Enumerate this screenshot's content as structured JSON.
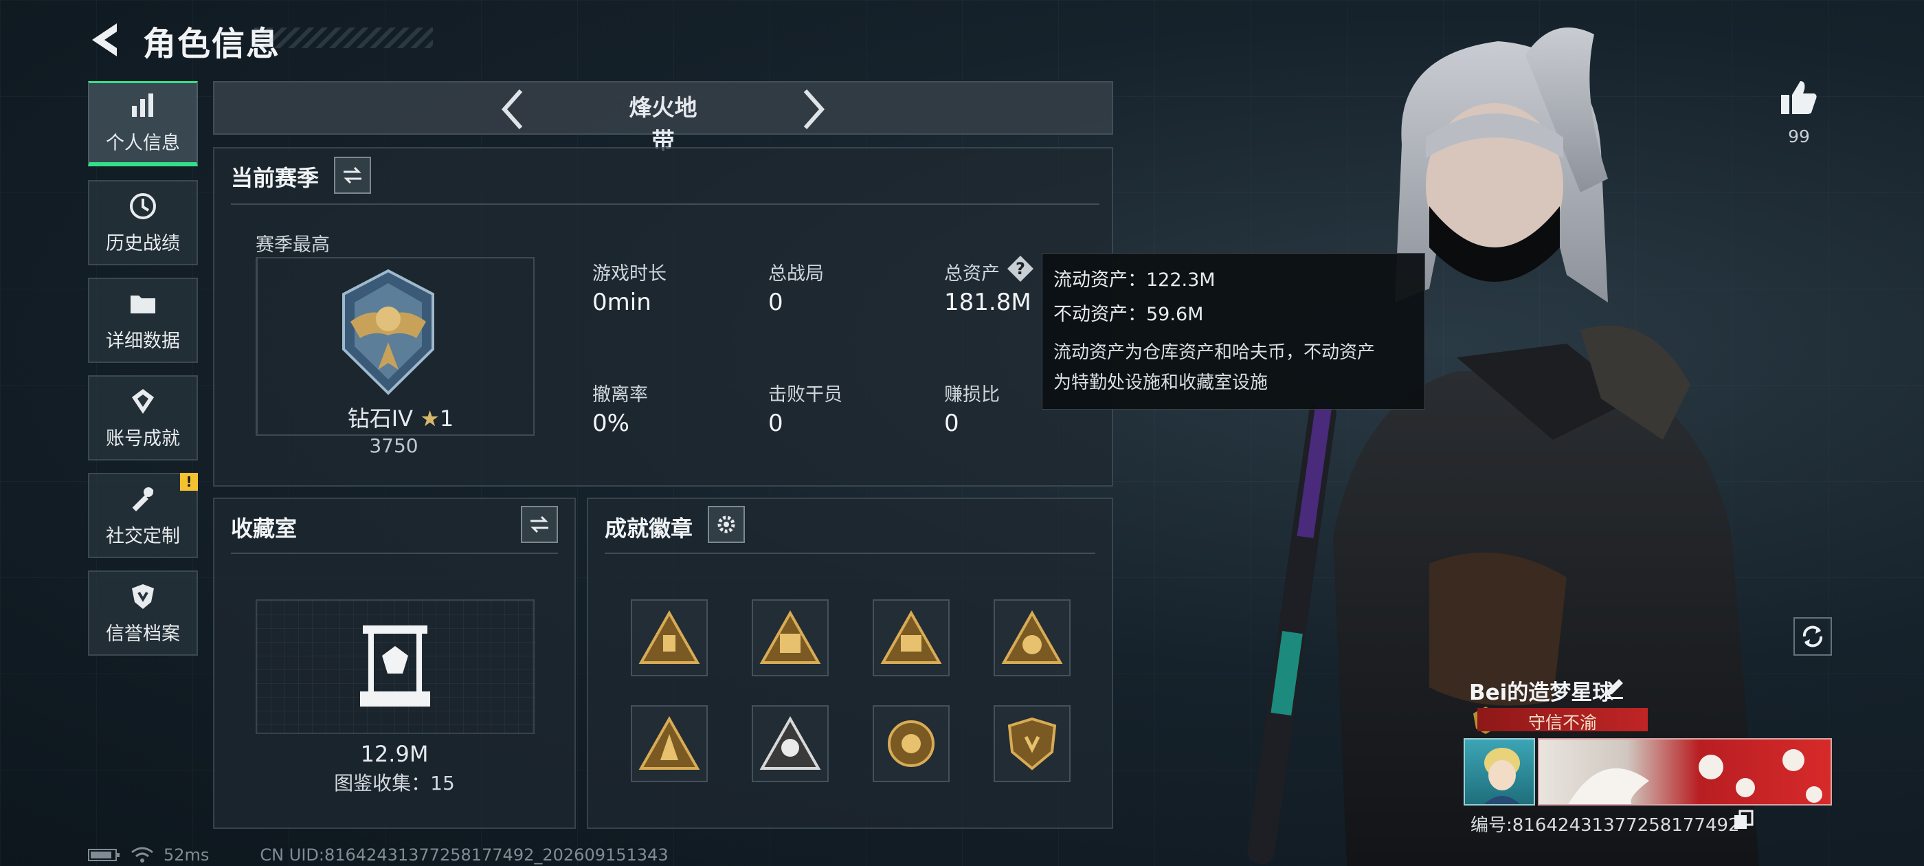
{
  "header": {
    "title": "角色信息"
  },
  "sidebar": {
    "items": [
      {
        "label": "个人信息",
        "active": true
      },
      {
        "label": "历史战绩"
      },
      {
        "label": "详细数据"
      },
      {
        "label": "账号成就"
      },
      {
        "label": "社交定制",
        "badge": "!"
      },
      {
        "label": "信誉档案"
      }
    ]
  },
  "mode": {
    "title": "烽火地带"
  },
  "season": {
    "title": "当前赛季",
    "best_label": "赛季最高",
    "rank_name": "钻石IV",
    "rank_stars": "1",
    "rank_points": "3750",
    "stats": [
      {
        "label": "游戏时长",
        "value": "0min"
      },
      {
        "label": "总战局",
        "value": "0"
      },
      {
        "label": "总资产",
        "value": "181.8M"
      },
      {
        "label": "撤离率",
        "value": "0%"
      },
      {
        "label": "击败干员",
        "value": "0"
      },
      {
        "label": "赚损比",
        "value": "0"
      }
    ]
  },
  "tooltip": {
    "liquid": "流动资产：122.3M",
    "fixed": "不动资产：59.6M",
    "desc_line1": "流动资产为仓库资产和哈夫币，不动资产",
    "desc_line2": "为特勤处设施和收藏室设施"
  },
  "collection": {
    "title": "收藏室",
    "value": "12.9M",
    "codex": "图鉴收集：15"
  },
  "achievements": {
    "title": "成就徽章"
  },
  "profile": {
    "likes": "99",
    "name": "Bei的造梦星球",
    "tag": "守信不渝",
    "id": "编号:81642431377258177492"
  },
  "status": {
    "ping": "52ms",
    "uid": "CN UID:81642431377258177492_202609151343"
  },
  "colors": {
    "accent": "#33e08a",
    "tag": "#b82020",
    "warn": "#f2c230"
  }
}
